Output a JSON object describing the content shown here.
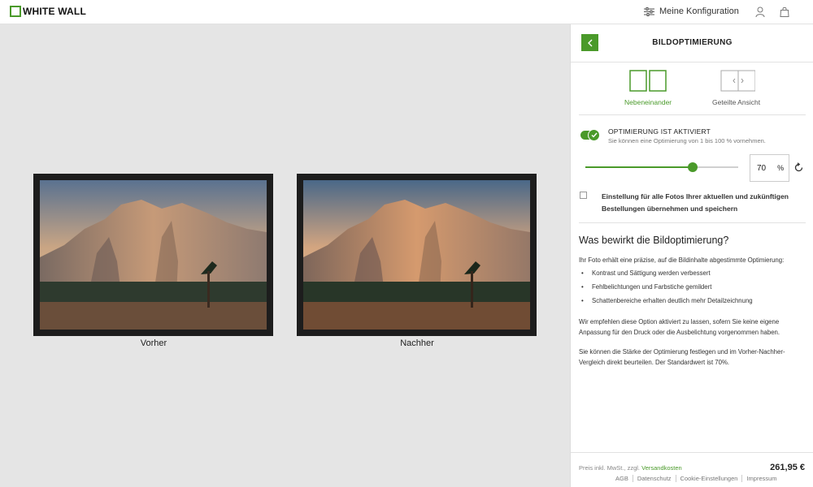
{
  "header": {
    "logo_text": "WHITE WALL",
    "config_label": "Meine Konfiguration",
    "icons": [
      "sliders-icon",
      "user-icon",
      "bag-icon"
    ]
  },
  "preview": {
    "before_label": "Vorher",
    "after_label": "Nachher"
  },
  "panel": {
    "title": "BILDOPTIMIERUNG",
    "views": [
      {
        "label": "Nebeneinander",
        "active": true
      },
      {
        "label": "Geteilte Ansicht",
        "active": false
      }
    ],
    "optimization": {
      "title": "OPTIMIERUNG IST AKTIVIERT",
      "subtitle": "Sie können eine Optimierung von 1 bis 100 % vornehmen.",
      "enabled": true,
      "value": "70",
      "unit": "%",
      "level_percent": 70
    },
    "save_for_all": {
      "label": "Einstellung für alle Fotos Ihrer aktuellen und zukünftigen Bestellungen übernehmen und speichern",
      "checked": false
    },
    "info": {
      "title": "Was bewirkt die Bildoptimierung?",
      "intro": "Ihr Foto erhält eine präzise, auf die Bildinhalte abgestimmte Optimierung:",
      "bullets": [
        "Kontrast und Sättigung werden verbessert",
        "Fehlbelichtungen und Farbstiche gemildert",
        "Schattenbereiche erhalten deutlich mehr Detailzeichnung"
      ],
      "para2": "Wir empfehlen diese Option aktiviert zu lassen, sofern Sie keine eigene Anpassung für den Druck oder die Ausbelichtung vorgenommen haben.",
      "para3": "Sie können die Stärke der Optimierung festlegen und im Vorher-Nachher-Vergleich direkt beurteilen. Der Standardwert ist 70%."
    },
    "footer": {
      "price_note": "Preis inkl. MwSt., zzgl.",
      "shipping_link": "Versandkosten",
      "price": "261,95 €",
      "links": [
        "AGB",
        "Datenschutz",
        "Cookie-Einstellungen",
        "Impressum"
      ]
    }
  },
  "colors": {
    "accent": "#4a9a2a",
    "canvas_bg": "#e5e5e5"
  }
}
